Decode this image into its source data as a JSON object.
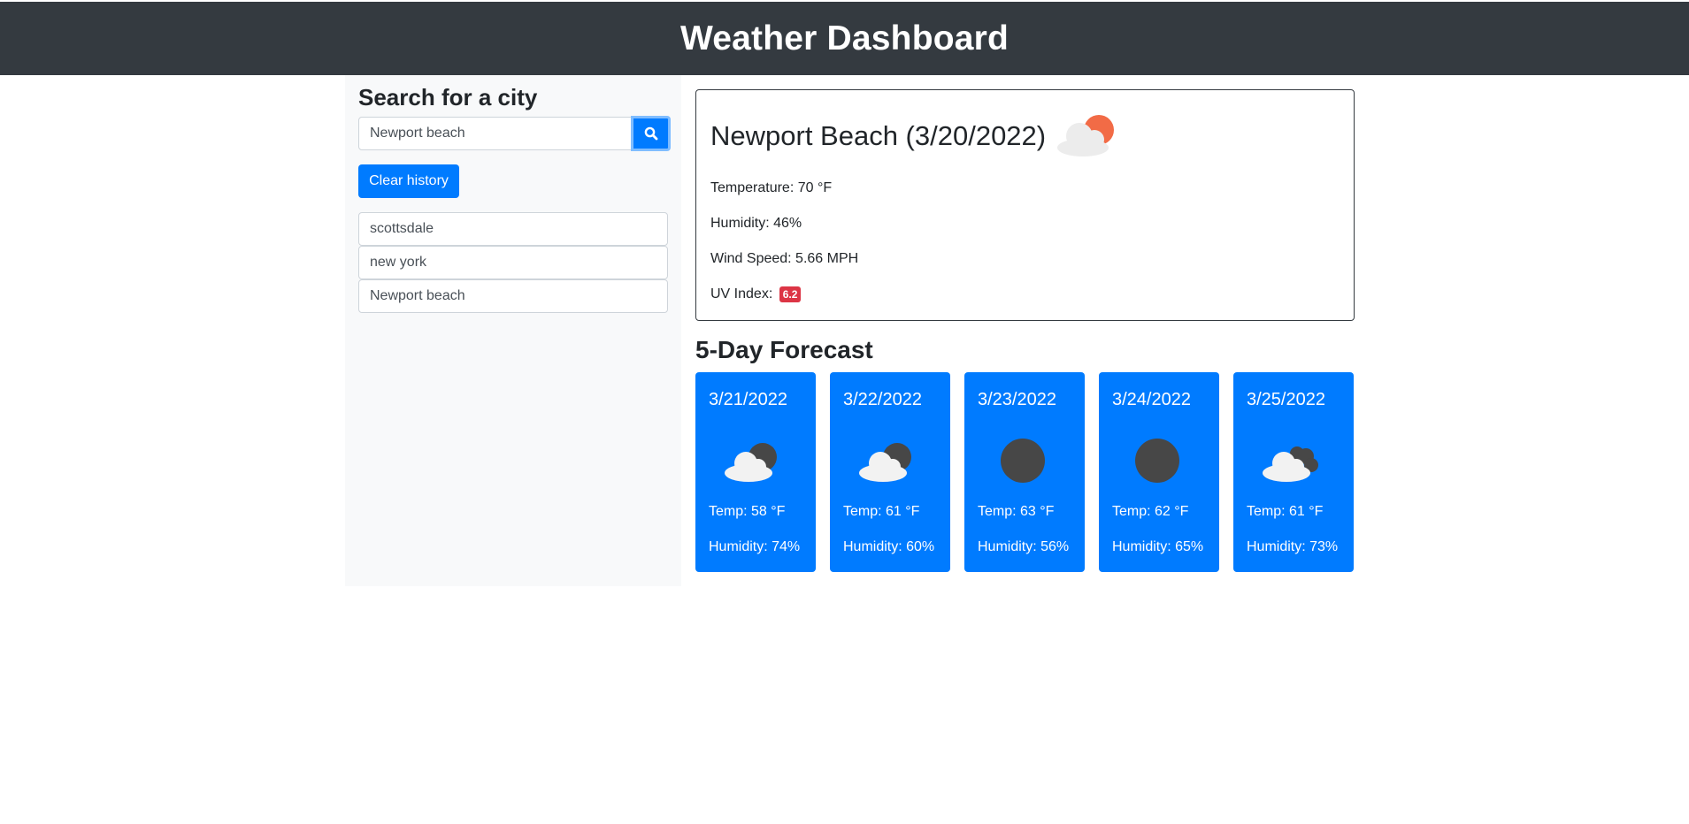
{
  "header": {
    "title": "Weather Dashboard"
  },
  "sidebar": {
    "heading": "Search for a city",
    "search_value": "Newport beach",
    "search_icon": "search-icon",
    "clear_label": "Clear history",
    "history": [
      "scottsdale",
      "new york",
      "Newport beach"
    ]
  },
  "current": {
    "title": "Newport Beach (3/20/2022)",
    "icon": "cloud-sun-icon",
    "temperature": "Temperature: 70 °F",
    "humidity": "Humidity: 46%",
    "wind": "Wind Speed: 5.66 MPH",
    "uv_label": "UV Index:",
    "uv_value": "6.2",
    "uv_color": "#dc3545"
  },
  "forecast": {
    "heading": "5-Day Forecast",
    "days": [
      {
        "date": "3/21/2022",
        "icon": "cloud-moon-icon",
        "temp": "Temp: 58 °F",
        "humidity": "Humidity: 74%"
      },
      {
        "date": "3/22/2022",
        "icon": "cloud-moon-icon",
        "temp": "Temp: 61 °F",
        "humidity": "Humidity: 60%"
      },
      {
        "date": "3/23/2022",
        "icon": "moon-icon",
        "temp": "Temp: 63 °F",
        "humidity": "Humidity: 56%"
      },
      {
        "date": "3/24/2022",
        "icon": "moon-icon",
        "temp": "Temp: 62 °F",
        "humidity": "Humidity: 65%"
      },
      {
        "date": "3/25/2022",
        "icon": "clouds-night-icon",
        "temp": "Temp: 61 °F",
        "humidity": "Humidity: 73%"
      }
    ]
  },
  "colors": {
    "navbar": "#343a40",
    "primary": "#007bff",
    "sidebar": "#f8f9fa"
  }
}
